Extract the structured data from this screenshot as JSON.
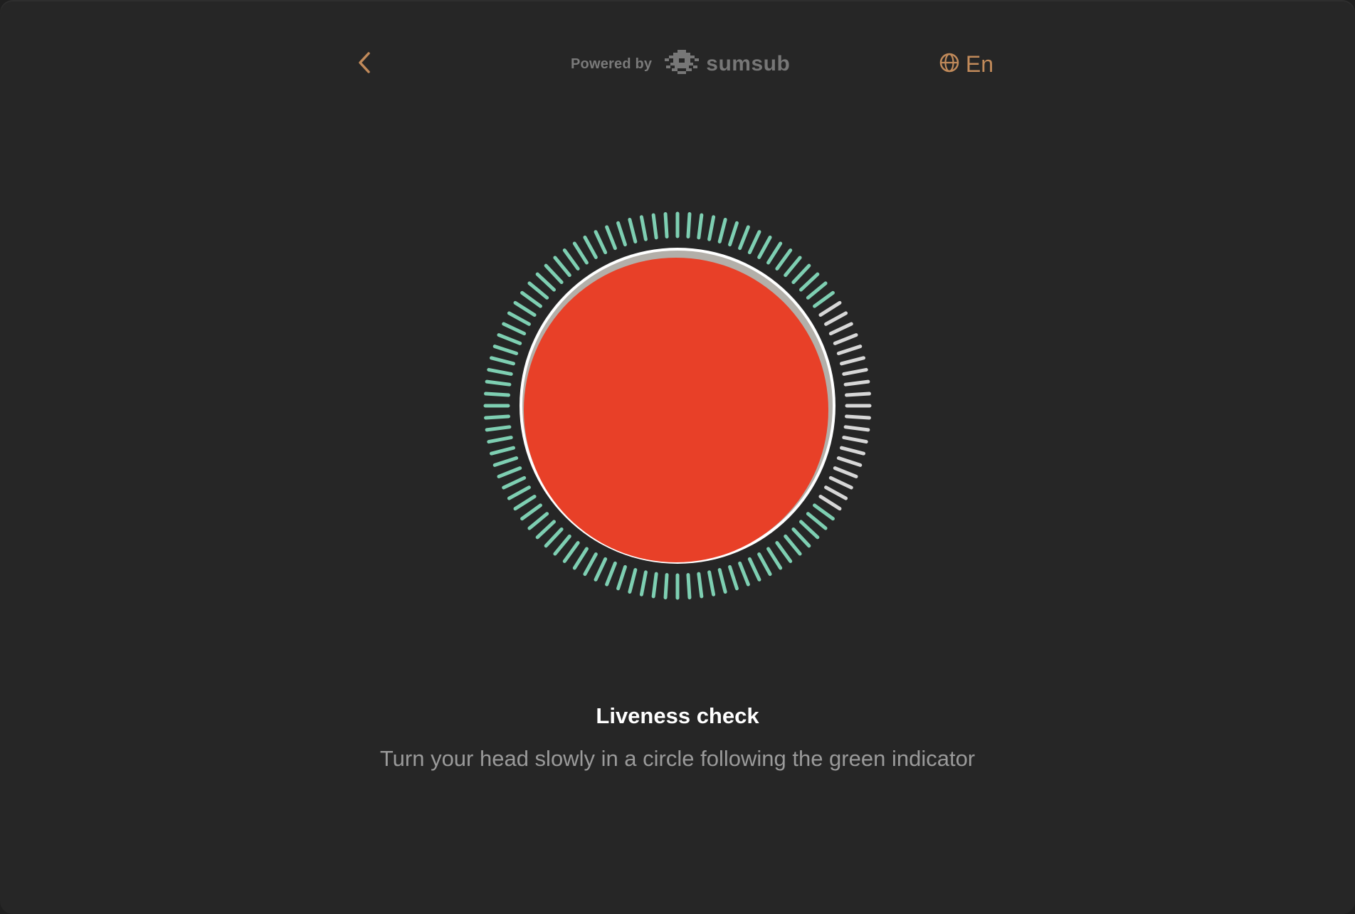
{
  "header": {
    "back_icon": "chevron-left-icon",
    "powered_label": "Powered by",
    "brand_name": "sumsub",
    "brand_icon": "sumsub-logo-icon",
    "language_icon": "globe-icon",
    "language_label": "En"
  },
  "liveness": {
    "title": "Liveness check",
    "instruction": "Turn your head slowly in a circle following the green indicator",
    "progress": 0.82,
    "active_color": "#7ecfb2",
    "inactive_color": "#d7d7d7",
    "face_color": "#e84028"
  },
  "colors": {
    "accent": "#c18a5a",
    "background": "#262626"
  }
}
